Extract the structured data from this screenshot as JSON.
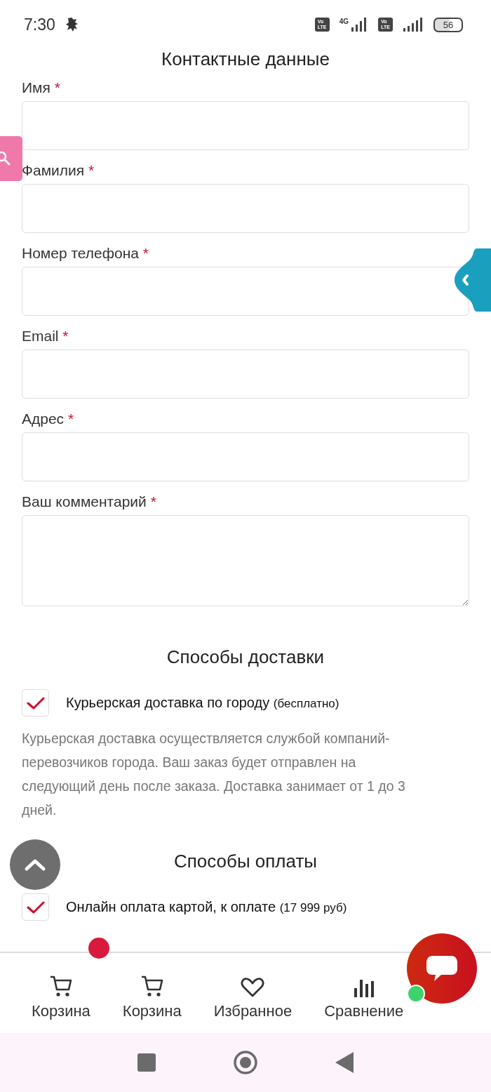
{
  "status_bar": {
    "time": "7:30",
    "sim_badges": [
      {
        "top": "Vo",
        "bottom": "LTE"
      },
      {
        "top": "Vo",
        "bottom": "LTE"
      }
    ],
    "network": "4G",
    "battery": "56"
  },
  "section_title": "Контактные данные",
  "fields": [
    {
      "label": "Имя",
      "required_mark": "*",
      "kind": "input"
    },
    {
      "label": "Фамилия",
      "required_mark": "*",
      "kind": "input"
    },
    {
      "label": "Номер телефона",
      "required_mark": "*",
      "kind": "input"
    },
    {
      "label": "Email",
      "required_mark": "*",
      "kind": "input"
    },
    {
      "label": "Адрес",
      "required_mark": "*",
      "kind": "input"
    },
    {
      "label": "Ваш комментарий",
      "required_mark": "*",
      "kind": "textarea"
    }
  ],
  "delivery": {
    "title": "Способы доставки",
    "option": {
      "label": "Курьерская доставка по городу",
      "note": "(бесплатно)",
      "checked": true
    },
    "description": "Курьерская доставка осуществляется службой компаний-перевозчиков города. Ваш заказ будет отправлен на следующий день после заказа. Доставка занимает от 1 до 3 дней."
  },
  "payment": {
    "title": "Способы оплаты",
    "option": {
      "label": "Онлайн оплата картой, к оплате",
      "note": "(17 999 руб)",
      "checked": true
    }
  },
  "bottom_nav": [
    {
      "label": "Корзина",
      "kind": "cart",
      "badge": true
    },
    {
      "label": "Корзина",
      "kind": "cart",
      "badge": false
    },
    {
      "label": "Избранное",
      "kind": "heart",
      "badge": false
    },
    {
      "label": "Сравнение",
      "kind": "chart",
      "badge": false
    }
  ],
  "chat": {
    "online": true
  }
}
